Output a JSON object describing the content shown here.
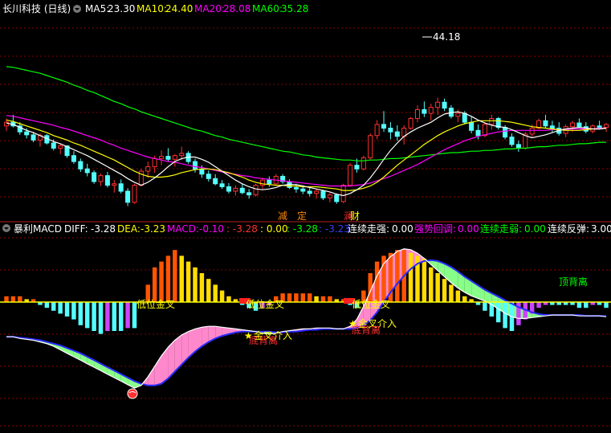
{
  "colors": {
    "background": "#000000",
    "grid": "#8b0000",
    "separator": "#b22222",
    "up_candle": "#ff3030",
    "down_candle": "#54ffff",
    "ma5": "#ffffff",
    "ma10": "#ffff00",
    "ma20": "#ff00ff",
    "ma60": "#00ff00",
    "hist_up_strong": "#ff5500",
    "hist_up_weak": "#ffdd00",
    "hist_down_strong": "#54ffff",
    "hist_down_weak": "#cc44ff",
    "diff_line": "#ffffff",
    "dea_line": "#2a2aff",
    "fill_bull": "#ff88cc",
    "fill_bear": "#88ff88",
    "signal_label": "#ffff00",
    "signal_label2": "#ff3030",
    "divergence_label": "#ff3030",
    "divergence_label_top": "#00ff00"
  },
  "header": {
    "title": "长川科技 (日线)",
    "ma5_label": "MA5:",
    "ma5_value": "23.30",
    "ma10_label": "MA10:",
    "ma10_value": "24.40",
    "ma20_label": "MA20:",
    "ma20_value": "28.08",
    "ma60_label": "MA60:",
    "ma60_value": "35.28"
  },
  "price_panel": {
    "high_marker": "44.18",
    "candles": [
      [
        30.4,
        31.4,
        29.7,
        30.9
      ],
      [
        30.9,
        31.9,
        30.2,
        30.4
      ],
      [
        30.4,
        30.9,
        29.2,
        29.6
      ],
      [
        29.6,
        30.1,
        28.7,
        29.2
      ],
      [
        29.2,
        29.6,
        28.2,
        28.5
      ],
      [
        28.5,
        29.4,
        27.6,
        29.1
      ],
      [
        29.1,
        29.3,
        27.9,
        28.1
      ],
      [
        28.1,
        28.6,
        27.1,
        27.4
      ],
      [
        27.4,
        28.0,
        26.6,
        27.7
      ],
      [
        27.7,
        27.8,
        26.1,
        26.4
      ],
      [
        26.4,
        27.0,
        25.3,
        25.6
      ],
      [
        25.6,
        26.0,
        24.2,
        24.6
      ],
      [
        24.6,
        25.3,
        23.6,
        24.1
      ],
      [
        24.1,
        24.4,
        22.6,
        22.9
      ],
      [
        22.9,
        24.0,
        22.3,
        23.7
      ],
      [
        23.7,
        24.2,
        22.1,
        22.4
      ],
      [
        22.4,
        23.1,
        21.4,
        22.6
      ],
      [
        22.6,
        23.2,
        21.3,
        21.6
      ],
      [
        21.6,
        22.0,
        19.6,
        20.1
      ],
      [
        20.1,
        22.6,
        19.9,
        22.4
      ],
      [
        22.4,
        24.6,
        22.2,
        24.3
      ],
      [
        24.3,
        25.6,
        23.4,
        24.9
      ],
      [
        24.9,
        26.4,
        24.1,
        26.0
      ],
      [
        26.0,
        27.1,
        25.1,
        26.3
      ],
      [
        26.3,
        27.4,
        25.6,
        25.9
      ],
      [
        25.9,
        26.6,
        24.9,
        26.4
      ],
      [
        26.4,
        27.6,
        25.8,
        26.7
      ],
      [
        26.7,
        27.0,
        25.3,
        25.6
      ],
      [
        25.6,
        26.0,
        24.1,
        24.6
      ],
      [
        24.6,
        25.1,
        23.4,
        23.9
      ],
      [
        23.9,
        24.4,
        22.9,
        23.3
      ],
      [
        23.3,
        23.9,
        22.4,
        22.6
      ],
      [
        22.6,
        23.1,
        21.9,
        22.2
      ],
      [
        22.2,
        22.7,
        21.3,
        21.6
      ],
      [
        21.6,
        22.4,
        21.0,
        22.0
      ],
      [
        22.0,
        22.6,
        21.2,
        21.4
      ],
      [
        21.4,
        21.9,
        20.6,
        21.1
      ],
      [
        21.1,
        22.6,
        20.9,
        22.4
      ],
      [
        22.4,
        23.4,
        21.9,
        23.1
      ],
      [
        23.1,
        23.6,
        22.2,
        22.6
      ],
      [
        22.6,
        23.9,
        22.4,
        23.6
      ],
      [
        23.6,
        23.9,
        22.6,
        22.9
      ],
      [
        22.9,
        23.2,
        21.9,
        22.1
      ],
      [
        22.1,
        22.6,
        21.4,
        21.9
      ],
      [
        21.9,
        22.4,
        21.2,
        21.6
      ],
      [
        21.6,
        22.1,
        20.9,
        21.3
      ],
      [
        21.3,
        21.9,
        20.6,
        21.6
      ],
      [
        21.6,
        21.8,
        20.4,
        20.7
      ],
      [
        20.7,
        21.4,
        20.1,
        21.1
      ],
      [
        21.1,
        21.3,
        19.9,
        20.2
      ],
      [
        20.2,
        22.6,
        20.0,
        22.4
      ],
      [
        22.4,
        25.4,
        22.2,
        25.1
      ],
      [
        25.1,
        26.0,
        24.1,
        24.6
      ],
      [
        24.6,
        26.4,
        24.4,
        26.1
      ],
      [
        26.1,
        29.4,
        25.9,
        29.1
      ],
      [
        29.1,
        31.2,
        28.6,
        30.6
      ],
      [
        30.6,
        32.4,
        29.6,
        30.1
      ],
      [
        30.1,
        30.9,
        28.6,
        29.6
      ],
      [
        29.6,
        30.5,
        28.4,
        29.0
      ],
      [
        29.0,
        30.5,
        27.9,
        30.1
      ],
      [
        30.1,
        31.6,
        29.9,
        31.4
      ],
      [
        31.4,
        33.2,
        30.9,
        32.6
      ],
      [
        32.6,
        33.7,
        31.6,
        32.1
      ],
      [
        32.1,
        33.4,
        31.1,
        32.9
      ],
      [
        32.9,
        34.2,
        31.9,
        33.6
      ],
      [
        33.6,
        34.1,
        32.4,
        32.8
      ],
      [
        32.8,
        33.2,
        31.4,
        31.7
      ],
      [
        31.7,
        32.6,
        30.9,
        32.1
      ],
      [
        32.1,
        32.4,
        30.6,
        30.9
      ],
      [
        30.9,
        31.6,
        29.4,
        29.8
      ],
      [
        29.8,
        30.6,
        28.6,
        29.1
      ],
      [
        29.1,
        30.9,
        28.9,
        30.6
      ],
      [
        30.6,
        31.9,
        29.9,
        31.4
      ],
      [
        31.4,
        31.6,
        29.9,
        30.2
      ],
      [
        30.2,
        30.5,
        28.6,
        28.9
      ],
      [
        28.9,
        29.4,
        27.6,
        27.9
      ],
      [
        27.9,
        28.4,
        26.9,
        27.4
      ],
      [
        27.4,
        29.6,
        27.2,
        29.3
      ],
      [
        29.3,
        30.6,
        28.9,
        30.1
      ],
      [
        30.1,
        31.4,
        29.9,
        31.1
      ],
      [
        31.1,
        31.9,
        30.1,
        30.4
      ],
      [
        30.4,
        31.1,
        29.6,
        30.1
      ],
      [
        30.1,
        30.9,
        29.1,
        29.4
      ],
      [
        29.4,
        30.6,
        28.9,
        30.3
      ],
      [
        30.3,
        31.1,
        29.6,
        30.8
      ],
      [
        30.8,
        31.4,
        30.1,
        30.3
      ],
      [
        30.3,
        30.9,
        29.4,
        29.7
      ],
      [
        29.7,
        30.6,
        29.4,
        30.4
      ],
      [
        30.4,
        31.1,
        29.9,
        30.2
      ],
      [
        30.2,
        30.8,
        29.6,
        30.6
      ]
    ],
    "ma5": [
      30.8,
      30.6,
      30.2,
      29.8,
      29.5,
      29.1,
      28.7,
      28.3,
      28.0,
      27.6,
      27.2,
      26.8,
      26.4,
      25.9,
      25.4,
      24.9,
      24.4,
      23.9,
      23.3,
      22.8,
      22.4,
      22.8,
      23.4,
      24.1,
      24.9,
      25.6,
      26.0,
      26.2,
      26.2,
      25.9,
      25.5,
      24.9,
      24.3,
      23.7,
      23.1,
      22.6,
      22.2,
      21.9,
      21.8,
      21.9,
      22.1,
      22.4,
      22.5,
      22.5,
      22.3,
      22.1,
      21.9,
      21.7,
      21.5,
      21.2,
      21.0,
      21.3,
      21.8,
      22.4,
      23.4,
      24.6,
      25.9,
      27.1,
      28.1,
      29.0,
      29.6,
      30.1,
      30.5,
      30.9,
      31.5,
      32.0,
      32.2,
      32.3,
      32.1,
      31.7,
      31.2,
      30.8,
      30.5,
      30.3,
      30.2,
      29.9,
      29.5,
      29.1,
      28.8,
      29.0,
      29.2,
      29.5,
      29.8,
      30.0,
      30.1,
      30.2,
      30.1,
      30.0,
      30.0,
      30.1
    ],
    "ma10": [
      31.2,
      31.0,
      30.7,
      30.4,
      30.1,
      29.8,
      29.5,
      29.1,
      28.8,
      28.5,
      28.1,
      27.8,
      27.4,
      27.0,
      26.6,
      26.2,
      25.8,
      25.3,
      24.8,
      24.3,
      23.9,
      23.6,
      23.5,
      23.5,
      23.6,
      23.8,
      24.1,
      24.3,
      24.5,
      24.6,
      24.6,
      24.5,
      24.3,
      24.1,
      23.8,
      23.5,
      23.1,
      22.8,
      22.6,
      22.5,
      22.4,
      22.4,
      22.3,
      22.3,
      22.2,
      22.2,
      22.2,
      22.1,
      22.0,
      21.9,
      21.7,
      21.7,
      21.8,
      22.0,
      22.3,
      22.8,
      23.5,
      24.3,
      25.1,
      25.8,
      26.5,
      27.2,
      27.9,
      28.5,
      29.1,
      29.6,
      30.0,
      30.4,
      30.7,
      30.9,
      31.1,
      31.1,
      31.1,
      31.1,
      31.0,
      30.9,
      30.7,
      30.5,
      30.3,
      30.2,
      30.1,
      30.0,
      29.9,
      29.8,
      29.8,
      29.8,
      29.9,
      30.0,
      30.0,
      30.1
    ],
    "ma20": [
      31.8,
      31.7,
      31.5,
      31.3,
      31.1,
      30.9,
      30.7,
      30.5,
      30.2,
      30.0,
      29.7,
      29.4,
      29.1,
      28.8,
      28.5,
      28.1,
      27.8,
      27.4,
      27.1,
      26.8,
      26.5,
      26.2,
      26.0,
      25.8,
      25.6,
      25.5,
      25.3,
      25.1,
      24.9,
      24.8,
      24.6,
      24.4,
      24.2,
      24.0,
      23.9,
      23.7,
      23.6,
      23.4,
      23.3,
      23.2,
      23.1,
      23.0,
      22.9,
      22.8,
      22.7,
      22.6,
      22.5,
      22.4,
      22.3,
      22.3,
      22.3,
      22.3,
      22.4,
      22.5,
      22.7,
      23.0,
      23.3,
      23.6,
      24.0,
      24.4,
      24.8,
      25.2,
      25.7,
      26.2,
      26.7,
      27.2,
      27.6,
      28.0,
      28.4,
      28.7,
      29.0,
      29.2,
      29.4,
      29.6,
      29.7,
      29.8,
      29.8,
      29.8,
      29.8,
      29.8,
      29.8,
      29.9,
      29.9,
      29.9,
      30.0,
      30.0,
      30.0,
      30.0,
      30.1,
      30.1
    ],
    "ma60": [
      38.4,
      38.3,
      38.1,
      37.9,
      37.7,
      37.5,
      37.2,
      36.9,
      36.6,
      36.3,
      35.9,
      35.6,
      35.2,
      34.9,
      34.5,
      34.1,
      33.7,
      33.4,
      33.0,
      32.7,
      32.3,
      32.0,
      31.7,
      31.4,
      31.1,
      30.8,
      30.5,
      30.2,
      29.9,
      29.7,
      29.4,
      29.1,
      28.9,
      28.6,
      28.4,
      28.2,
      28.0,
      27.8,
      27.6,
      27.4,
      27.2,
      27.0,
      26.9,
      26.7,
      26.5,
      26.4,
      26.2,
      26.1,
      26.0,
      25.9,
      25.8,
      25.8,
      25.7,
      25.7,
      25.8,
      25.8,
      25.9,
      26.0,
      26.0,
      26.1,
      26.2,
      26.3,
      26.4,
      26.5,
      26.6,
      26.7,
      26.8,
      26.8,
      26.9,
      27.0,
      27.0,
      27.1,
      27.1,
      27.2,
      27.3,
      27.3,
      27.4,
      27.4,
      27.5,
      27.6,
      27.6,
      27.7,
      27.8,
      27.8,
      27.9,
      28.0,
      28.0,
      28.1,
      28.2,
      28.2
    ]
  },
  "indicator_header": {
    "name": "暴利MACD",
    "diff_label": "DIFF:",
    "diff_value": "-3.28",
    "dea_label": "DEA:",
    "dea_value": "-3.23",
    "macd_label": "MACD:",
    "macd_value": "-0.10",
    "v4": ": -3.28",
    "v5": ": 0.00",
    "v6": ": -3.28",
    "v7": ": -3.23",
    "lxzq_label": "连续走强:",
    "lxzq_value": "0.00",
    "qshd_label": "强势回调:",
    "qshd_value": "0.00",
    "lxzr_label": "连续走弱:",
    "lxzr_value": "0.00",
    "lxfd_label": "连续反弹:",
    "lxfd_value": "3.00"
  },
  "markers": {
    "jian": "减",
    "ding": "定",
    "lan": "澜",
    "cai": "财"
  },
  "annotations": {
    "dw_jincha_1": "低位金叉",
    "dw_jincha_2": "低位金叉",
    "dw_jincha_3": "低位金叉",
    "jincha_jieru_1": "金叉介入",
    "jincha_jieru_2": "金叉介入",
    "di_beili_1": "底背离",
    "di_beili_2": "底背离",
    "ding_beili": "顶背离"
  },
  "chart_data": {
    "type": "candlestick+indicator",
    "histogram": [
      1,
      1,
      1,
      0.5,
      0.5,
      -0.5,
      -1,
      -1.5,
      -2,
      -2.5,
      -3,
      -4,
      -4.5,
      -5,
      -5.5,
      -5,
      -5,
      -5,
      -4.5,
      -4.5,
      0,
      3,
      6,
      7,
      8,
      9,
      8,
      7,
      6,
      5,
      4,
      3,
      2,
      1,
      0.5,
      -0.5,
      -1,
      -1.5,
      -1,
      -0.5,
      1,
      1.5,
      1.5,
      1.5,
      1.5,
      1.5,
      1,
      1,
      1,
      0.5,
      0.5,
      -0.5,
      -1,
      2,
      5,
      7,
      8,
      8.5,
      9,
      9,
      8.5,
      8,
      7.5,
      6,
      5,
      4,
      3,
      2,
      1,
      0.5,
      -0.5,
      -1.5,
      -2.5,
      -3.5,
      -4.5,
      -5,
      -4,
      -3,
      -2,
      -1,
      -0.5,
      -0.5,
      -0.5,
      -0.5,
      -0.5,
      -1,
      -1,
      -0.5,
      -0.5,
      -1
    ],
    "diff": [
      -3.0,
      -3.0,
      -3.2,
      -3.3,
      -3.4,
      -3.6,
      -3.8,
      -4.1,
      -4.5,
      -4.9,
      -5.3,
      -5.7,
      -6.1,
      -6.5,
      -6.9,
      -7.3,
      -7.7,
      -8.1,
      -8.5,
      -8.9,
      -8.6,
      -7.6,
      -6.4,
      -5.2,
      -4.2,
      -3.4,
      -2.8,
      -2.4,
      -2.1,
      -1.9,
      -1.8,
      -1.8,
      -1.9,
      -2.0,
      -2.1,
      -2.2,
      -2.3,
      -2.4,
      -2.6,
      -2.7,
      -2.6,
      -2.4,
      -2.3,
      -2.2,
      -2.1,
      -2.1,
      -2.0,
      -2.0,
      -2.0,
      -2.1,
      -2.1,
      -1.8,
      -1.0,
      0.5,
      2.2,
      4.0,
      5.4,
      6.2,
      6.8,
      7.1,
      7.0,
      6.6,
      6.0,
      5.3,
      4.6,
      3.9,
      3.2,
      2.6,
      2.1,
      1.7,
      1.4,
      1.1,
      0.7,
      0.2,
      -0.3,
      -0.7,
      -0.9,
      -0.9,
      -0.8,
      -0.7,
      -0.6,
      -0.5,
      -0.5,
      -0.5,
      -0.5,
      -0.6,
      -0.6,
      -0.6,
      -0.6,
      -0.7
    ],
    "dea": [
      -3.0,
      -3.0,
      -3.1,
      -3.2,
      -3.3,
      -3.4,
      -3.6,
      -3.8,
      -4.0,
      -4.3,
      -4.6,
      -4.9,
      -5.3,
      -5.7,
      -6.1,
      -6.5,
      -6.9,
      -7.3,
      -7.7,
      -8.1,
      -8.4,
      -8.6,
      -8.6,
      -8.4,
      -7.8,
      -7.0,
      -6.2,
      -5.4,
      -4.7,
      -4.1,
      -3.6,
      -3.2,
      -2.9,
      -2.7,
      -2.5,
      -2.4,
      -2.4,
      -2.4,
      -2.4,
      -2.4,
      -2.5,
      -2.5,
      -2.4,
      -2.4,
      -2.3,
      -2.2,
      -2.2,
      -2.1,
      -2.1,
      -2.1,
      -2.1,
      -2.1,
      -2.0,
      -1.7,
      -1.1,
      -0.2,
      1.0,
      2.1,
      3.1,
      4.0,
      4.8,
      5.4,
      5.7,
      5.8,
      5.7,
      5.4,
      5.0,
      4.5,
      3.9,
      3.4,
      2.9,
      2.4,
      2.0,
      1.6,
      1.2,
      0.8,
      0.4,
      0.1,
      -0.2,
      -0.4,
      -0.5,
      -0.5,
      -0.5,
      -0.5,
      -0.5,
      -0.5,
      -0.6,
      -0.6,
      -0.6,
      -0.6
    ]
  }
}
